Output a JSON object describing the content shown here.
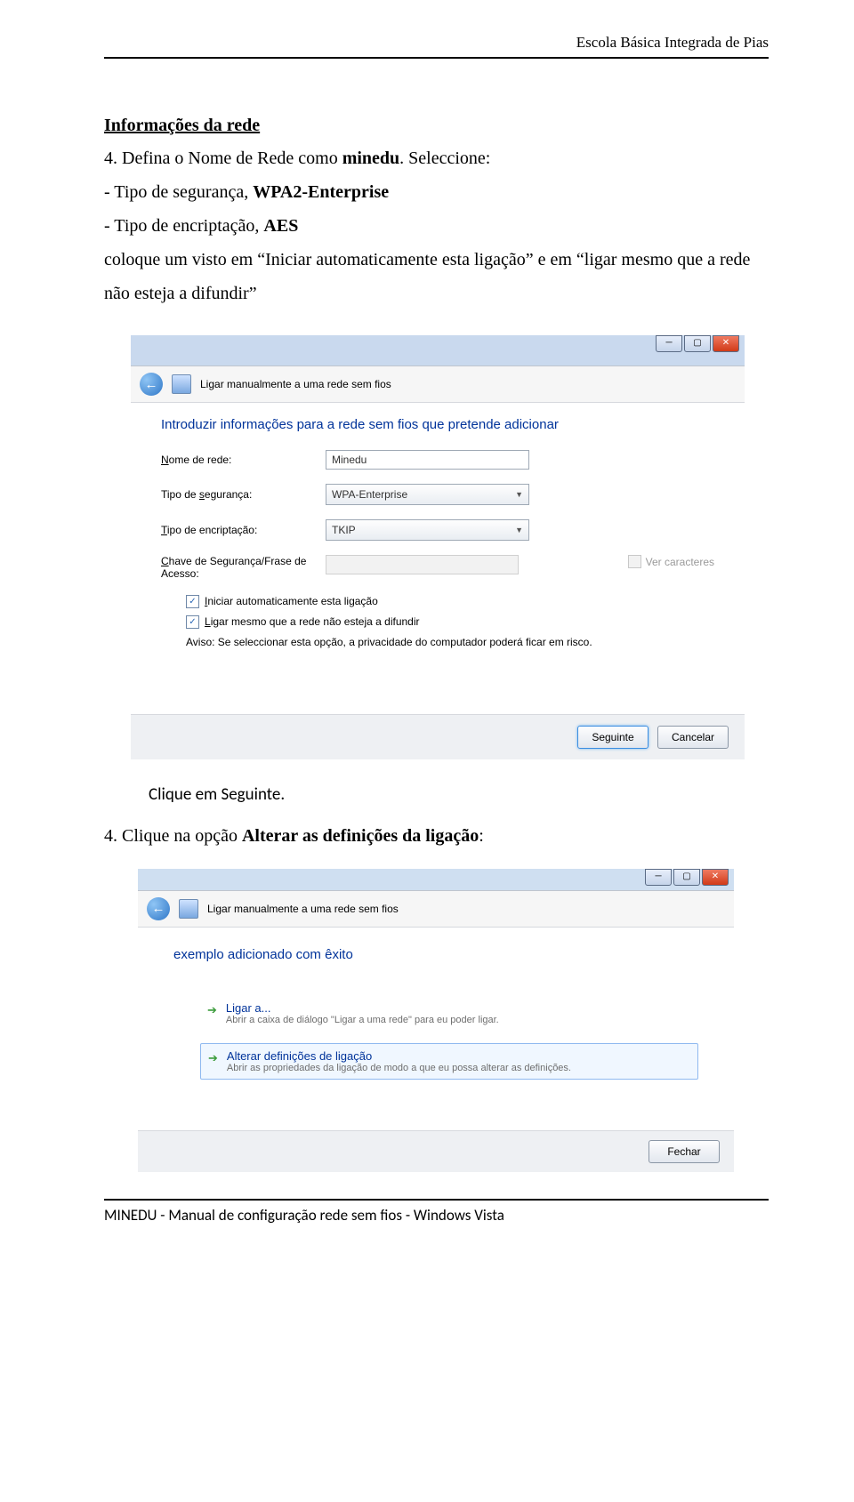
{
  "header": {
    "school": "Escola Básica Integrada de Pias"
  },
  "section": {
    "title": "Informações da rede"
  },
  "step4_intro": {
    "line_pre": "4. Defina o Nome de Rede como ",
    "bold1": "minedu",
    "line_post": ". Seleccione:"
  },
  "bullets": {
    "b1_pre": " - Tipo de segurança, ",
    "b1_bold": "WPA2-Enterprise",
    "b2_pre": " - Tipo de encriptação, ",
    "b2_bold": "AES"
  },
  "para2": "coloque um visto em “Iniciar automaticamente esta ligação” e em “ligar mesmo que a rede não esteja a difundir”",
  "ss1": {
    "bar_title": "Ligar manualmente a uma rede sem fios",
    "heading": "Introduzir informações para a rede sem fios que pretende adicionar",
    "lbl_nome": "Nome de rede:",
    "val_nome": "Minedu",
    "lbl_seg": "Tipo de segurança:",
    "val_seg": "WPA-Enterprise",
    "lbl_enc": "Tipo de encriptação:",
    "val_enc": "TKIP",
    "lbl_chave": "Chave de Segurança/Frase de Acesso:",
    "ver": "Ver caracteres",
    "chk1": "Iniciar automaticamente esta ligação",
    "chk2": "Ligar mesmo que a rede não esteja a difundir",
    "aviso": "Aviso: Se seleccionar esta opção, a privacidade do computador poderá ficar em risco.",
    "seguinte": "Seguinte",
    "cancelar": "Cancelar"
  },
  "caption1": "Clique em Seguinte.",
  "step4b": {
    "pre": "4. Clique na opção ",
    "bold": "Alterar as definições da ligação",
    "post": ":"
  },
  "ss2": {
    "bar_title": "Ligar manualmente a uma rede sem fios",
    "heading": "exemplo adicionado com êxito",
    "opt1_t": "Ligar a...",
    "opt1_s": "Abrir a caixa de diálogo \"Ligar a uma rede\" para eu poder ligar.",
    "opt2_t": "Alterar definições de ligação",
    "opt2_s": "Abrir as propriedades da ligação de modo a que eu possa alterar as definições.",
    "fechar": "Fechar"
  },
  "footer": "MINEDU - Manual de configuração rede sem fios - Windows Vista"
}
